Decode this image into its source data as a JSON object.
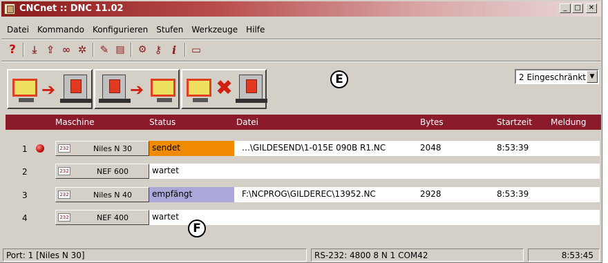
{
  "window": {
    "title": "CNCnet :: DNC 11.02",
    "controls": {
      "minimize": "_",
      "maximize": "□",
      "close": "✕"
    }
  },
  "menu": [
    "Datei",
    "Kommando",
    "Konfigurieren",
    "Stufen",
    "Werkzeuge",
    "Hilfe"
  ],
  "toolbar": [
    {
      "icon": "help-icon",
      "glyph": "?",
      "color": "#c01010"
    },
    {
      "icon": "download-icon",
      "glyph": "⤓",
      "color": "#8b3030"
    },
    {
      "icon": "upload-icon",
      "glyph": "⇪",
      "color": "#8b3030"
    },
    {
      "icon": "link-icon",
      "glyph": "∞",
      "color": "#8b3030"
    },
    {
      "icon": "gear-icon",
      "glyph": "✲",
      "color": "#8b1a1a"
    },
    {
      "icon": "pencil-icon",
      "glyph": "✎",
      "color": "#8b1a1a"
    },
    {
      "icon": "trash-icon",
      "glyph": "▤",
      "color": "#8b1a1a"
    },
    {
      "icon": "machine-icon",
      "glyph": "⚙",
      "color": "#8b1a1a"
    },
    {
      "icon": "key-icon",
      "glyph": "⚷",
      "color": "#8b1a1a"
    },
    {
      "icon": "info-icon",
      "glyph": "i",
      "color": "#8b1a1a"
    },
    {
      "icon": "message-icon",
      "glyph": "▭",
      "color": "#8b1a1a"
    }
  ],
  "callouts": {
    "upper": "E",
    "lower": "F"
  },
  "dropdown": {
    "value": "2 Eingeschränkt",
    "arrow": "▼"
  },
  "columns": {
    "machine": "Maschine",
    "status": "Status",
    "file": "Datei",
    "bytes": "Bytes",
    "start": "Startzeit",
    "message": "Meldung"
  },
  "rows": [
    {
      "num": "1",
      "led": true,
      "tag": "232",
      "machine": "Niles N 30",
      "status": "sendet",
      "status_color": "#f08a00",
      "file": "…\\GILDESEND\\1-015E 090B R1.NC",
      "bytes": "2048",
      "start": "8:53:39",
      "message": ""
    },
    {
      "num": "2",
      "led": false,
      "tag": "232",
      "machine": "NEF 600",
      "status": "wartet",
      "status_color": "#ffffff",
      "file": "",
      "bytes": "",
      "start": "",
      "message": ""
    },
    {
      "num": "3",
      "led": false,
      "tag": "232",
      "machine": "Niles N 40",
      "status": "empfängt",
      "status_color": "#aaa8d8",
      "file": "F:\\NCPROG\\GILDEREC\\13952.NC",
      "bytes": "2928",
      "start": "8:53:39",
      "message": ""
    },
    {
      "num": "4",
      "led": false,
      "tag": "232",
      "machine": "NEF 400",
      "status": "wartet",
      "status_color": "#ffffff",
      "file": "",
      "bytes": "",
      "start": "",
      "message": ""
    }
  ],
  "statusbar": {
    "port": "Port: 1 [Niles N 30]",
    "serial": "RS-232: 4800 8 N 1 COM42",
    "time": "8:53:45"
  }
}
